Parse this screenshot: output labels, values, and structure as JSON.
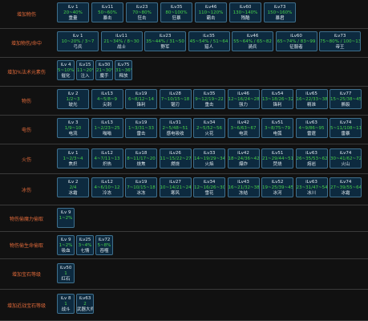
{
  "rows": [
    {
      "label": "增加物伤",
      "chips": [
        {
          "ilv": "iLv 1",
          "range": "20~40%",
          "name": "重量"
        },
        {
          "ilv": "iLv11",
          "range": "50~60%",
          "name": "暴击"
        },
        {
          "ilv": "iLv23",
          "range": "70~80%",
          "name": "狂击"
        },
        {
          "ilv": "iLv35",
          "range": "80~100%",
          "name": "狂暴"
        },
        {
          "ilv": "iLv46",
          "range": "110~120%",
          "name": "霸击"
        },
        {
          "ilv": "iLv60",
          "range": "130~140%",
          "name": "残酷"
        },
        {
          "ilv": "iLv73",
          "range": "150~160%",
          "name": "暴君"
        }
      ]
    },
    {
      "label": "增加物伤/命中",
      "chips": [
        {
          "ilv": "iLv 1",
          "range": "10~20% / 3~7",
          "name": "弓兵"
        },
        {
          "ilv": "iLv11",
          "range": "21~34% / 8~30",
          "name": "战士"
        },
        {
          "ilv": "iLv23",
          "range": "35~44% / 31~50",
          "name": "野军"
        },
        {
          "ilv": "iLv35",
          "range": "45~54% / 51~64",
          "name": "猎人"
        },
        {
          "ilv": "iLv46",
          "range": "55~64% / 65~82",
          "name": "骑兵"
        },
        {
          "ilv": "iLv60",
          "range": "65~74% / 83~99",
          "name": "征服者"
        },
        {
          "ilv": "iLv73",
          "range": "75~80% / 100~135",
          "name": "帝王"
        }
      ]
    },
    {
      "label": "增加%法术元素伤",
      "chips": [
        {
          "ilv": "iLv 4",
          "range": "5~10%",
          "name": "催化"
        },
        {
          "ilv": "iLv15",
          "range": "11~20%",
          "name": "注入"
        },
        {
          "ilv": "iLv30",
          "range": "21~30%",
          "name": "魔手"
        },
        {
          "ilv": "iLv75",
          "range": "31~36%",
          "name": "释放"
        }
      ]
    },
    {
      "label": "物伤",
      "chips": [
        {
          "ilv": "iLv 2",
          "range": "1/2~3",
          "name": "玻光"
        },
        {
          "ilv": "iLv13",
          "range": "4~5/8~9",
          "name": "尖刺"
        },
        {
          "ilv": "iLv19",
          "range": "6~8/12~14",
          "name": "锋利"
        },
        {
          "ilv": "iLv28",
          "range": "7~10/15~18",
          "name": "锯刃"
        },
        {
          "ilv": "iLv35",
          "range": "9~12/19~22",
          "name": "重击"
        },
        {
          "ilv": "iLv46",
          "range": "12~16/24~28",
          "name": "强力"
        },
        {
          "ilv": "iLv54",
          "range": "13~18/26~32",
          "name": "锋利"
        },
        {
          "ilv": "iLv65",
          "range": "16~22/33~38",
          "name": "精准"
        },
        {
          "ilv": "iLv77",
          "range": "15~25/38~45",
          "name": "撕裂"
        }
      ]
    },
    {
      "label": "电伤",
      "chips": [
        {
          "ilv": "iLv 3",
          "range": "1/9~10",
          "name": "电流"
        },
        {
          "ilv": "iLv13",
          "range": "1~2/23~25",
          "name": "嗡嗡"
        },
        {
          "ilv": "iLv19",
          "range": "1~3/31~33",
          "name": "雷击"
        },
        {
          "ilv": "iLv31",
          "range": "2~5/48~51",
          "name": "感电吸收"
        },
        {
          "ilv": "iLv34",
          "range": "2~5/52~56",
          "name": "火花"
        },
        {
          "ilv": "iLv42",
          "range": "3~6/63~67",
          "name": "电流"
        },
        {
          "ilv": "iLv51",
          "range": "3~8/75~79",
          "name": "电弧"
        },
        {
          "ilv": "iLv63",
          "range": "4~9/86~95",
          "name": "雷霆"
        },
        {
          "ilv": "iLv74",
          "range": "5~11/108~115",
          "name": "雷暴"
        }
      ]
    },
    {
      "label": "火伤",
      "chips": [
        {
          "ilv": "iLv 1",
          "range": "1~2/3~4",
          "name": "焦炽"
        },
        {
          "ilv": "iLv12",
          "range": "4~7/11~13",
          "name": "炽热"
        },
        {
          "ilv": "iLv18",
          "range": "8~11/17~20",
          "name": "烧焦"
        },
        {
          "ilv": "iLv26",
          "range": "11~15/22~27",
          "name": "燃烧"
        },
        {
          "ilv": "iLv33",
          "range": "14~19/29~34",
          "name": "火焰"
        },
        {
          "ilv": "iLv42",
          "range": "18~24/36~42",
          "name": "爆炸"
        },
        {
          "ilv": "iLv51",
          "range": "21~29/44~51",
          "name": "焚烧"
        },
        {
          "ilv": "iLv63",
          "range": "26~35/53~62",
          "name": "熔岩"
        },
        {
          "ilv": "iLv74",
          "range": "30~41/62~72",
          "name": "火山"
        }
      ]
    },
    {
      "label": "冰伤",
      "chips": [
        {
          "ilv": "iLv 2",
          "range": "2/4",
          "name": "冰霜"
        },
        {
          "ilv": "iLv12",
          "range": "4~6/10~12",
          "name": "冷冻"
        },
        {
          "ilv": "iLv19",
          "range": "7~10/15~18",
          "name": "冰冻"
        },
        {
          "ilv": "iLv27",
          "range": "10~14/21~24",
          "name": "寒风"
        },
        {
          "ilv": "iLv34",
          "range": "12~16/26~30",
          "name": "雪花"
        },
        {
          "ilv": "iLv43",
          "range": "16~21/32~38",
          "name": "冻结"
        },
        {
          "ilv": "iLv52",
          "range": "19~25/39~45",
          "name": "冰河"
        },
        {
          "ilv": "iLv63",
          "range": "23~31/47~54",
          "name": "冰川"
        },
        {
          "ilv": "iLv74",
          "range": "27~39/55~64",
          "name": "冰霜"
        }
      ]
    },
    {
      "label": "物伤偷魔力偷取",
      "chips": [
        {
          "ilv": "iLv 9",
          "range": "1~2%",
          "name": ""
        }
      ]
    },
    {
      "label": "物伤偷生命偷取",
      "chips": [
        {
          "ilv": "iLv 9",
          "range": "1~2%",
          "name": "吸血"
        },
        {
          "ilv": "iLv25",
          "range": "3~4%",
          "name": "七情"
        },
        {
          "ilv": "iLv72",
          "range": "5~8%",
          "name": "吞噬"
        }
      ]
    },
    {
      "label": "增加宝石等级",
      "chips": [
        {
          "ilv": "iLv50",
          "range": "1",
          "name": "红石"
        }
      ]
    },
    {
      "label": "增加近战宝石等级",
      "chips": [
        {
          "ilv": "iLv 8",
          "range": "1",
          "name": "战斗"
        },
        {
          "ilv": "iLv63",
          "range": "2",
          "name": "武器大师"
        }
      ]
    }
  ]
}
